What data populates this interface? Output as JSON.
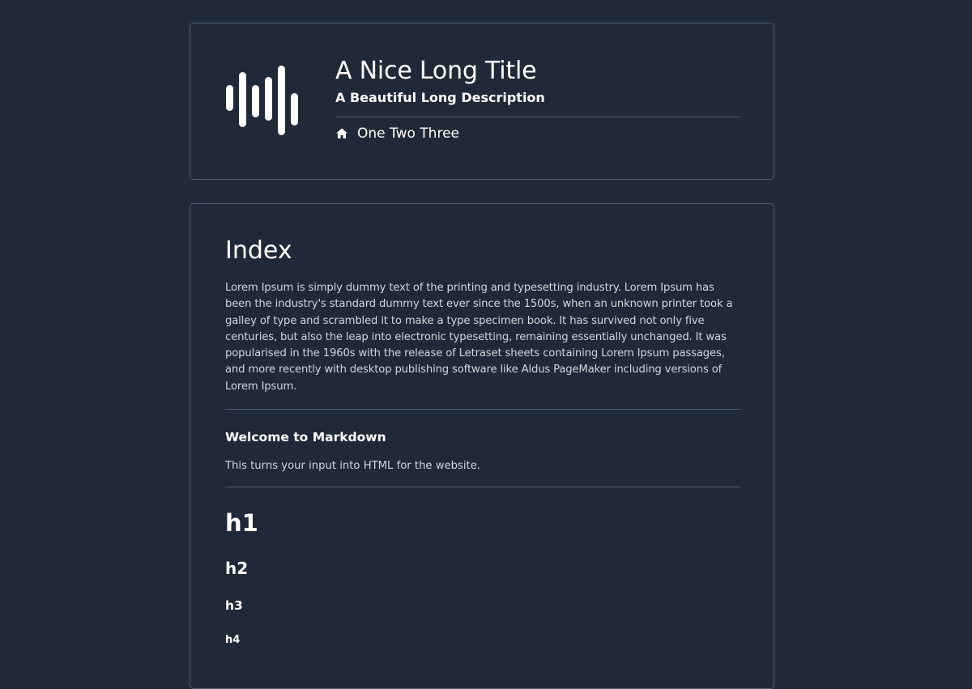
{
  "header": {
    "title": "A Nice Long Title",
    "description": "A Beautiful Long Description",
    "nav_label": "One Two Three",
    "logo_icon": "waveform-icon",
    "nav_icon": "home-icon"
  },
  "content": {
    "heading": "Index",
    "intro": "Lorem Ipsum is simply dummy text of the printing and typesetting industry. Lorem Ipsum has been the industry's standard dummy text ever since the 1500s, when an unknown printer took a galley of type and scrambled it to make a type specimen book. It has survived not only five centuries, but also the leap into electronic typesetting, remaining essentially unchanged. It was popularised in the 1960s with the release of Letraset sheets containing Lorem Ipsum passages, and more recently with desktop publishing software like Aldus PageMaker including versions of Lorem Ipsum.",
    "section_title": "Welcome to Markdown",
    "section_text": "This turns your input into HTML for the website.",
    "h1": "h1",
    "h2": "h2",
    "h3": "h3",
    "h4": "h4"
  },
  "colors": {
    "background": "#1f2937",
    "border": "#4b5e70",
    "text": "#ffffff",
    "muted_text": "#d1d5db"
  }
}
